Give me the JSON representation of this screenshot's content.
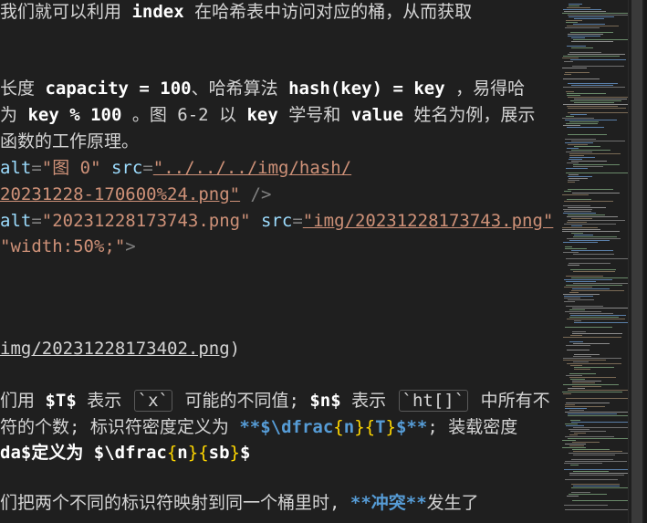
{
  "editor": {
    "lines": {
      "l1_a": "我们就可以利用 ",
      "l1_b": "index",
      "l1_c": " 在哈希表中访问对应的桶，从而获取",
      "l2_a": "长度 ",
      "l2_b": "capacity = 100",
      "l2_c": "、哈希算法 ",
      "l2_d": "hash(key) = key",
      "l2_e": " ，易得哈",
      "l3_a": "为 ",
      "l3_b": "key % 100",
      "l3_c": " 。图 6-2 以 ",
      "l3_d": "key",
      "l3_e": " 学号和 ",
      "l3_f": "value",
      "l3_g": " 姓名为例，展示",
      "l4": "函数的工作原理。",
      "l5_attr": "alt",
      "l5_val": "\"图 0\"",
      "l5_attr2": "src",
      "l5_src": "\"../../../img/hash/",
      "l6_src": "20231228-170600%24.png\"",
      "l6_close": " />",
      "l7_attr": "alt",
      "l7_val": "\"20231228173743.png\"",
      "l7_attr2": "src",
      "l7_src": "\"img/20231228173743.png\"",
      "l8_val": "\"width:50%;\"",
      "l8_close": ">",
      "l9": "img/20231228173402.png",
      "l9_close": ")",
      "l10_a": "们用 ",
      "l10_b": "$T$",
      "l10_c": " 表示 ",
      "l10_d": "`x`",
      "l10_e": " 可能的不同值; ",
      "l10_f": "$n$",
      "l10_g": " 表示 ",
      "l10_h": "`ht[]`",
      "l10_i": " 中所有不",
      "l11_a": "符的个数; 标识符密度定义为 ",
      "l11_b": "**$\\dfrac",
      "l11_c": "{",
      "l11_d": "n",
      "l11_e": "}{",
      "l11_f": "T",
      "l11_g": "}",
      "l11_h": "$**",
      "l11_i": "; 装载密度",
      "l12_a": "da$定义为 ",
      "l12_b": "$\\dfrac",
      "l12_c": "{",
      "l12_d": "n",
      "l12_e": "}{",
      "l12_f": "sb",
      "l12_g": "}",
      "l12_h": "$",
      "l13_a": "们把两个不同的标识符映射到同一个桶里时, ",
      "l13_b": "**冲突**",
      "l13_c": "发生了"
    }
  },
  "colors": {
    "background": "#1f1f1f",
    "text": "#d4d4d4",
    "string": "#ce9178",
    "attribute": "#9cdcfe",
    "bold": "#569cd6",
    "brace": "#ffd700"
  }
}
